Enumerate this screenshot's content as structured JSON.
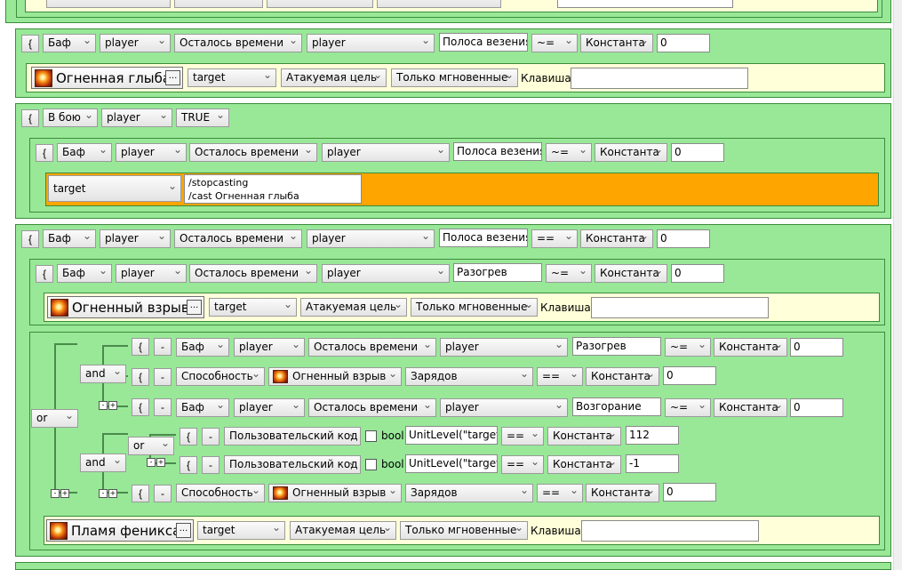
{
  "common": {
    "brace": "{",
    "minus": "-",
    "more": "...",
    "key_label": "Клавиша:",
    "bool_label": "bool",
    "mini_minus": "-",
    "mini_plus": "+",
    "const": "Константа",
    "player": "player",
    "target": "target",
    "buff": "Баф",
    "time_left": "Осталось времени",
    "attack_target": "Атакуемая цель",
    "instant_only": "Только мгновенные",
    "ability": "Способность",
    "charges": "Зарядов",
    "custom_code": "Пользовательский код"
  },
  "top_group": {
    "key_value": ""
  },
  "block1": {
    "cond": {
      "aura": "Полоса везения",
      "op": "~=",
      "value": "0"
    },
    "action": {
      "spell": "Огненная глыба",
      "key_value": ""
    }
  },
  "block2": {
    "cond": {
      "type": "В бою",
      "unit": "player",
      "value": "TRUE"
    },
    "sub": {
      "cond": {
        "aura": "Полоса везения",
        "op": "~=",
        "value": "0"
      },
      "macro": {
        "unit": "target",
        "text": "/stopcasting\n/cast Огненная глыба"
      }
    }
  },
  "block3": {
    "cond": {
      "aura": "Полоса везения",
      "op": "==",
      "value": "0"
    },
    "sub": {
      "cond": {
        "aura": "Разогрев",
        "op": "~=",
        "value": "0"
      },
      "action": {
        "spell": "Огненный взрыв",
        "key_value": ""
      }
    },
    "logic": {
      "or_label": "or",
      "and_label": "and",
      "rows": [
        {
          "aura": "Разогрев",
          "op": "~=",
          "value": "0"
        },
        {
          "spell": "Огненный взрыв",
          "op": "==",
          "value": "0"
        },
        {
          "aura": "Возгорание",
          "op": "~=",
          "value": "0"
        },
        {
          "code": "UnitLevel(\"target\")",
          "op": "==",
          "value": "112"
        },
        {
          "code": "UnitLevel(\"target\")",
          "op": "==",
          "value": "-1"
        },
        {
          "spell": "Огненный взрыв",
          "op": "==",
          "value": "0"
        }
      ]
    },
    "action": {
      "spell": "Пламя феникса",
      "key_value": ""
    }
  },
  "colors": {
    "group_bg": "#98e898",
    "action_bg": "#ffffd9",
    "macro_bg": "#ffa500",
    "border": "#3b8c3b"
  },
  "icons": [
    "fire-spell-icon",
    "checkbox"
  ]
}
